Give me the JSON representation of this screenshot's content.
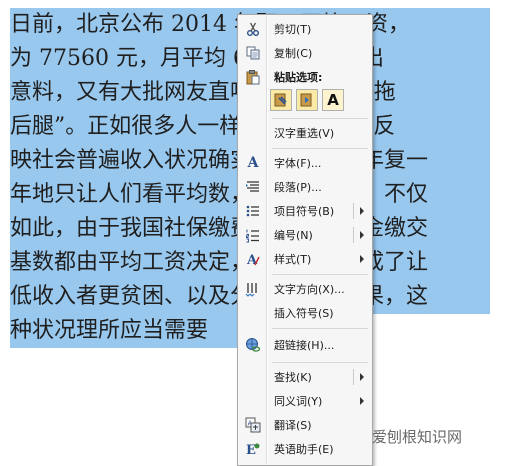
{
  "document": {
    "lines": [
      "日前，北京公布 2014 年职工平均工资，",
      "为 77560 元，月平均 6463 元。不出",
      "意料，又有大批网友直呼“被平均”、“拖",
      "后腿”。正如很多人一样，平均工资来反",
      "映社会普遍收入状况确实是片面的，年复一",
      "年地只让人们看平均数，实在是忽悠。不仅",
      "如此，由于我国社保缴费基数、公积金缴交",
      "基数都由平均工资决定，这实际上造成了让",
      "低收入者更贫困、以及分配不公的效果，这",
      "种状况理所应当需要"
    ]
  },
  "context_menu": {
    "cut": "剪切(T)",
    "copy": "复制(C)",
    "paste_options": "粘贴选项:",
    "paste_buttons": [
      "keep-source-formatting",
      "merge-formatting",
      "keep-text-only"
    ],
    "paste_text_glyph": "A",
    "reconvert": "汉字重选(V)",
    "font": "字体(F)...",
    "paragraph": "段落(P)...",
    "bullets": "项目符号(B)",
    "numbering": "编号(N)",
    "styles": "样式(T)",
    "text_direction": "文字方向(X)...",
    "insert_symbol": "插入符号(S)",
    "hyperlink": "超链接(H)...",
    "find": "查找(K)",
    "synonyms": "同义词(Y)",
    "translate": "翻译(S)",
    "english_assistant": "英语助手(E)"
  },
  "watermark": "爱刨根知识网",
  "colors": {
    "selection": "#99c8ee",
    "menu_bg": "#f6f6f6"
  }
}
